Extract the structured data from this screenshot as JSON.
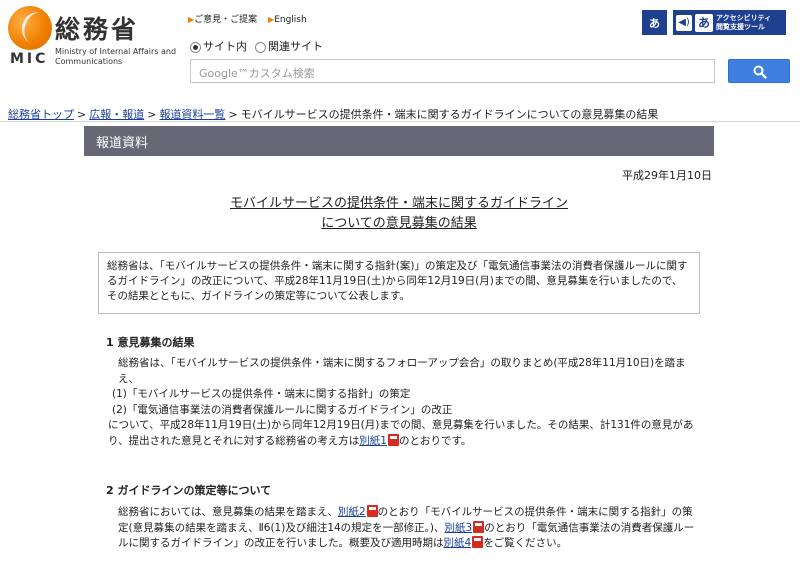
{
  "header": {
    "logo_jp": "総務省",
    "logo_abbr": "MIC",
    "logo_en": "Ministry of Internal Affairs and Communications",
    "links": [
      {
        "label": "ご意見・ご提案"
      },
      {
        "label": "English"
      }
    ],
    "scope_options": [
      {
        "label": "サイト内",
        "selected": true
      },
      {
        "label": "関連サイト",
        "selected": false
      }
    ],
    "search_placeholder": "Google™カスタム検索",
    "accessibility": {
      "font_button": "あ",
      "voice_glyph": "あ",
      "tool_label_line1": "アクセシビリティ",
      "tool_label_line2": "閲覧支援ツール"
    }
  },
  "breadcrumb": [
    {
      "label": "総務省トップ",
      "link": true
    },
    {
      "label": "広報・報道",
      "link": true
    },
    {
      "label": "報道資料一覧",
      "link": true
    },
    {
      "label": "モバイルサービスの提供条件・端末に関するガイドラインについての意見募集の結果",
      "link": false
    }
  ],
  "breadcrumb_sep": ">",
  "banner": "報道資料",
  "date": "平成29年1月10日",
  "title_line1": "モバイルサービスの提供条件・端末に関するガイドライン",
  "title_line2": "についての意見募集の結果",
  "summary": "総務省は、「モバイルサービスの提供条件・端末に関する指針(案)」の策定及び「電気通信事業法の消費者保護ルールに関するガイドライン」の改正について、平成28年11月19日(土)から同年12月19日(月)までの間、意見募集を行いましたので、その結果とともに、ガイドラインの策定等について公表します。",
  "section1": {
    "heading": "1  意見募集の結果",
    "intro": "総務省は、「モバイルサービスの提供条件・端末に関するフォローアップ会合」の取りまとめ(平成28年11月10日)を踏まえ、",
    "item1": "(1)「モバイルサービスの提供条件・端末に関する指針」の策定",
    "item2": "(2)「電気通信事業法の消費者保護ルールに関するガイドライン」の改正",
    "body_before": "について、平成28年11月19日(土)から同年12月19日(月)までの間、意見募集を行いました。その結果、計131件の意見があり、提出された意見とそれに対する総務省の考え方は",
    "link1": "別紙1",
    "body_after": "のとおりです。"
  },
  "section2": {
    "heading": "2  ガイドラインの策定等について",
    "p1": "総務省においては、意見募集の結果を踏まえ、",
    "link2": "別紙2",
    "p2": "のとおり「モバイルサービスの提供条件・端末に関する指針」の策定(意見募集の結果を踏まえ、Ⅱ6(1)及び細注14の規定を一部修正。)、",
    "link3": "別紙3",
    "p3": "のとおり「電気通信事業法の消費者保護ルールに関するガイドライン」の改正を行いました。概要及び適用時期は",
    "link4": "別紙4",
    "p4": "をご覧ください。"
  }
}
